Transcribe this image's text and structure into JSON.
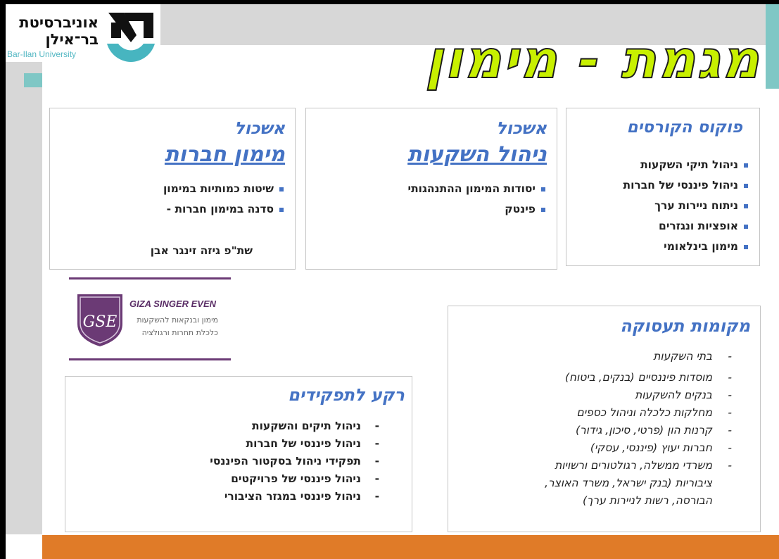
{
  "logo": {
    "hebrew_line1": "אוניברסיטת",
    "hebrew_line2": "בר־אילן",
    "english": "Bar-Ilan University",
    "mark_icon": "bar-ilan-logo-mark"
  },
  "title": "מגמת - מימון",
  "focus": {
    "heading": "פוקוס הקורסים",
    "items": [
      "ניהול תיקי השקעות",
      "ניהול פיננסי של חברות",
      "ניתוח ניירות ערך",
      "אופציות ונגזרים",
      "מימון בינלאומי"
    ]
  },
  "invest_cluster": {
    "heading": "אשכול",
    "name": "ניהול השקעות",
    "items": [
      "",
      "יסודות המימון ההתנהגותי",
      "פינטק"
    ]
  },
  "corp_cluster": {
    "heading": "אשכול",
    "name": "מימון חברות",
    "items": [
      "",
      "שיטות כמותיות במימון",
      "סדנה במימון חברות -"
    ],
    "sub": "שת\"פ  גיזה זינגר אבן"
  },
  "gse_logo": {
    "name": "GIZA SINGER EVEN",
    "tagline1": "מימון ובנקאות להשקעות",
    "tagline2": "כלכלת תחרות ורגולציה",
    "shield_icon": "gse-shield-icon"
  },
  "roles": {
    "heading": "רקע לתפקידים",
    "items": [
      "ניהול תיקים והשקעות",
      "ניהול פיננסי של חברות",
      "תפקידי ניהול בסקטור הפיננסי",
      "ניהול פיננסי של פרויקטים",
      "ניהול פיננסי במגזר הציבורי"
    ]
  },
  "jobs": {
    "heading": "מקומות תעסוקה",
    "items": [
      "בתי השקעות",
      "מוסדות פיננסיים  (בנקים, ביטוח)",
      "בנקים להשקעות",
      "מחלקות כלכלה וניהול כספים",
      "קרנות הון (פרטי, סיכון, גידור)",
      "חברות יעוץ (פיננסי, עסקי)",
      "משרדי ממשלה, רגולטורים ורשויות"
    ],
    "last_item_cont1": "ציבוריות (בנק ישראל, משרד האוצר,",
    "last_item_cont2": "הבורסה, רשות לניירות ערך)"
  },
  "colors": {
    "accent_blue": "#4472c4",
    "title_lime": "#c8f000",
    "teal": "#7fc7c5",
    "orange": "#e07b28",
    "gse_purple": "#6b3a75"
  }
}
